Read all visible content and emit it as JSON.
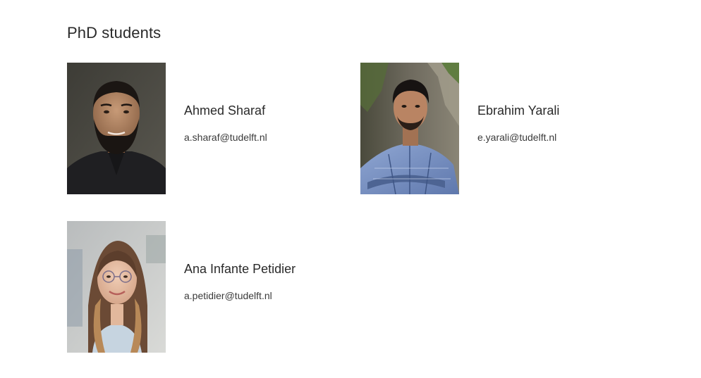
{
  "section": {
    "title": "PhD students"
  },
  "people": [
    {
      "name": "Ahmed Sharaf",
      "email": "a.sharaf@tudelft.nl"
    },
    {
      "name": "Ebrahim Yarali",
      "email": "e.yarali@tudelft.nl"
    },
    {
      "name": "Ana Infante Petidier",
      "email": "a.petidier@tudelft.nl"
    }
  ]
}
